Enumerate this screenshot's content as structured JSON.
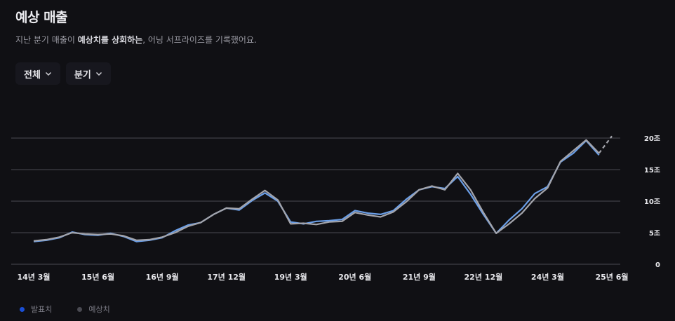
{
  "header": {
    "title": "예상 매출",
    "subtitle_pre": "지난 분기 매출이 ",
    "subtitle_bold": "예상치를 상회하는",
    "subtitle_post": ", 어닝 서프라이즈를 기록했어요."
  },
  "filters": [
    {
      "label": "전체"
    },
    {
      "label": "분기"
    }
  ],
  "legend": [
    {
      "label": "발표치",
      "color": "#1a4fd6"
    },
    {
      "label": "예상치",
      "color": "#4a4a52"
    }
  ],
  "colors": {
    "actual": "#6b9fe8",
    "estimate": "#a3a4ab",
    "grid": "#4a4a52",
    "tick": "#e8e8ec"
  },
  "chart_data": {
    "type": "line",
    "ylim": [
      0,
      20
    ],
    "y_ticks": [
      {
        "value": 20,
        "label": "20조"
      },
      {
        "value": 15,
        "label": "15조"
      },
      {
        "value": 10,
        "label": "10조"
      },
      {
        "value": 5,
        "label": "5조"
      },
      {
        "value": 0,
        "label": "0"
      }
    ],
    "x": [
      "14년 3월",
      "14년 6월",
      "14년 9월",
      "14년 12월",
      "15년 3월",
      "15년 6월",
      "15년 9월",
      "15년 12월",
      "16년 3월",
      "16년 6월",
      "16년 9월",
      "16년 12월",
      "17년 3월",
      "17년 6월",
      "17년 9월",
      "17년 12월",
      "18년 3월",
      "18년 6월",
      "18년 9월",
      "18년 12월",
      "19년 3월",
      "19년 6월",
      "19년 9월",
      "19년 12월",
      "20년 3월",
      "20년 6월",
      "20년 9월",
      "20년 12월",
      "21년 3월",
      "21년 6월",
      "21년 9월",
      "21년 12월",
      "22년 3월",
      "22년 6월",
      "22년 9월",
      "22년 12월",
      "23년 3월",
      "23년 6월",
      "23년 9월",
      "23년 12월",
      "24년 3월",
      "24년 6월",
      "24년 9월",
      "24년 12월",
      "25년 3월",
      "25년 6월"
    ],
    "x_tick_labels": [
      "14년 3월",
      "15년 6월",
      "16년 9월",
      "17년 12월",
      "19년 3월",
      "20년 6월",
      "21년 9월",
      "22년 12월",
      "24년 3월",
      "25년 6월"
    ],
    "series": [
      {
        "name": "발표치",
        "values": [
          3.6,
          3.8,
          4.2,
          5.1,
          4.7,
          4.6,
          4.9,
          4.4,
          3.6,
          3.8,
          4.2,
          5.3,
          6.2,
          6.6,
          7.9,
          8.9,
          8.6,
          10.1,
          11.3,
          10,
          6.7,
          6.4,
          6.8,
          6.9,
          7.1,
          8.5,
          8.1,
          7.9,
          8.5,
          10.3,
          11.8,
          12.3,
          12.0,
          13.9,
          11.1,
          7.9,
          4.9,
          7.0,
          8.8,
          11.2,
          12.3,
          16.2,
          17.6,
          19.6,
          17.3
        ],
        "color": "#6b9fe8"
      },
      {
        "name": "예상치",
        "values": [
          3.7,
          3.9,
          4.3,
          5.0,
          4.8,
          4.7,
          4.8,
          4.5,
          3.8,
          3.9,
          4.3,
          5.0,
          6.0,
          6.6,
          7.9,
          8.9,
          8.8,
          10.3,
          11.7,
          10.2,
          6.4,
          6.5,
          6.3,
          6.7,
          6.8,
          8.2,
          7.8,
          7.5,
          8.3,
          9.9,
          11.8,
          12.4,
          11.8,
          14.4,
          11.8,
          8.2,
          4.9,
          6.4,
          8.1,
          10.4,
          12.1,
          16.3,
          18.0,
          19.7,
          17.6,
          20.3
        ]
      }
    ]
  }
}
